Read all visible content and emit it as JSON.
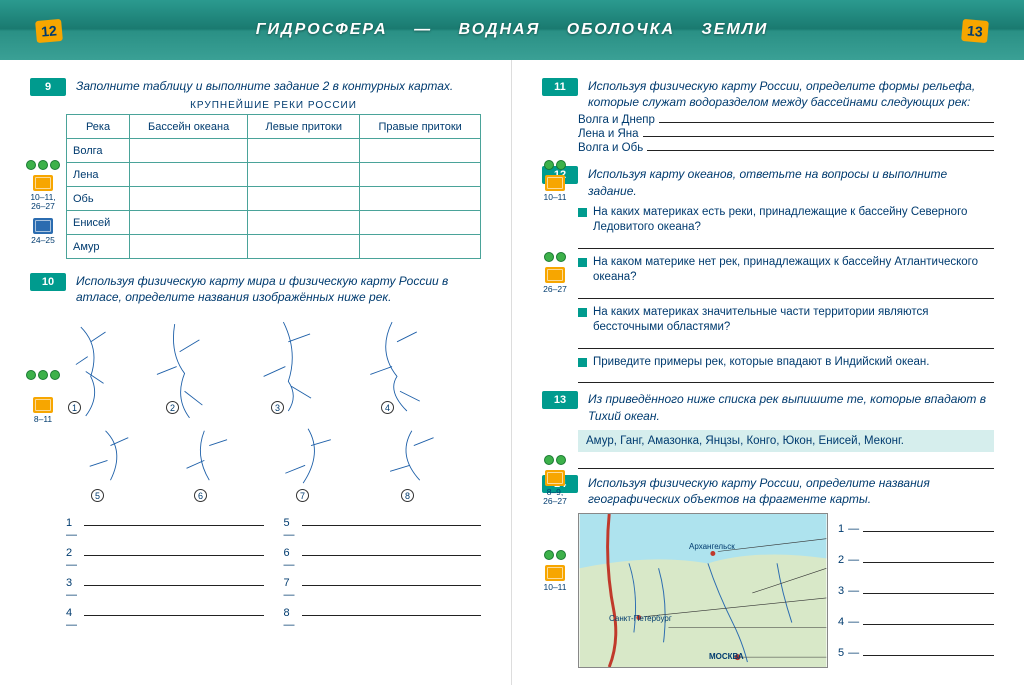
{
  "banner": {
    "title": "ГИДРОСФЕРА — ВОДНАЯ ОБОЛОЧКА ЗЕМЛИ"
  },
  "pages": {
    "left": "12",
    "right": "13"
  },
  "task9": {
    "num": "9",
    "prompt": "Заполните таблицу и выполните задание 2 в контурных картах.",
    "caption": "КРУПНЕЙШИЕ РЕКИ РОССИИ",
    "headers": [
      "Река",
      "Бассейн океана",
      "Левые притоки",
      "Правые притоки"
    ],
    "rows": [
      "Волга",
      "Лена",
      "Обь",
      "Енисей",
      "Амур"
    ],
    "refs": [
      "10–11, 26–27",
      "24–25"
    ]
  },
  "task10": {
    "num": "10",
    "prompt": "Используя физическую карту мира и физическую карту России в атласе, определите названия изображённых ниже рек.",
    "ref": "8–11",
    "labels": [
      "1",
      "2",
      "3",
      "4",
      "5",
      "6",
      "7",
      "8"
    ]
  },
  "task11": {
    "num": "11",
    "prompt": "Используя физическую карту России, определите формы рельефа, которые служат водоразделом между бассейнами следующих рек:",
    "lines": [
      "Волга и Днепр",
      "Лена и Яна",
      "Волга и Обь"
    ],
    "ref": "10–11"
  },
  "task12": {
    "num": "12",
    "prompt": "Используя карту океанов, ответьте на вопросы и выполните задание.",
    "ref": "26–27",
    "questions": [
      "На каких материках есть реки, принадлежащие к бассейну Северного Ледовитого океана?",
      "На каком материке нет рек, принадлежащих к бассейну Атлантического океана?",
      "На каких материках значительные части территории являются бессточными областями?",
      "Приведите примеры рек, которые впадают в Индийский океан."
    ]
  },
  "task13": {
    "num": "13",
    "prompt": "Из приведённого ниже списка рек выпишите те, которые впадают в Тихий океан.",
    "ref": "8–9, 26–27",
    "list": "Амур, Ганг, Амазонка, Янцзы, Конго, Юкон, Енисей, Меконг."
  },
  "task14": {
    "num": "14",
    "prompt": "Используя физическую карту России, определите названия географических объектов на фрагменте карты.",
    "ref": "10–11",
    "cities": [
      "Архангельск",
      "Санкт-Петербург",
      "МОСКВА"
    ],
    "labels": [
      "1",
      "2",
      "3",
      "4",
      "5"
    ]
  }
}
